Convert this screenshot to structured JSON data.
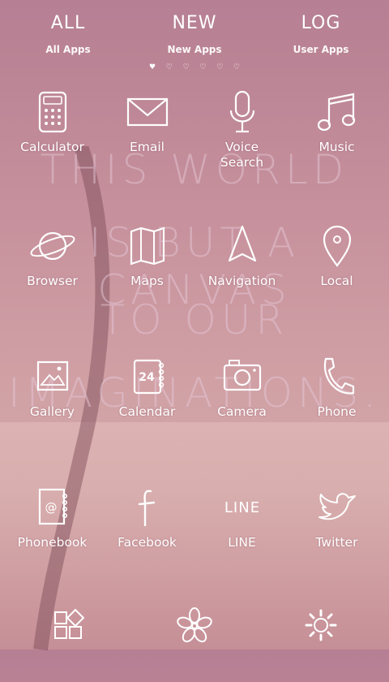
{
  "wallpaper": {
    "lines": [
      "THIS WORLD",
      "IS BUT A CANVAS",
      "TO OUR",
      "IMAGINATIONS."
    ]
  },
  "tabs": [
    {
      "symbol": "ALL",
      "label": "All Apps",
      "icon": "all-apps-icon"
    },
    {
      "symbol": "NEW",
      "label": "New Apps",
      "icon": "new-apps-icon"
    },
    {
      "symbol": "LOG",
      "label": "User Apps",
      "icon": "user-apps-icon"
    }
  ],
  "apps": [
    {
      "label": "Calculator",
      "icon": "calculator-icon"
    },
    {
      "label": "Email",
      "icon": "email-icon"
    },
    {
      "label": "Voice\nSearch",
      "icon": "microphone-icon"
    },
    {
      "label": "Music",
      "icon": "music-note-icon"
    },
    {
      "label": "Browser",
      "icon": "planet-icon"
    },
    {
      "label": "Maps",
      "icon": "map-icon"
    },
    {
      "label": "Navigation",
      "icon": "navigation-arrow-icon"
    },
    {
      "label": "Local",
      "icon": "location-pin-icon"
    },
    {
      "label": "Gallery",
      "icon": "picture-icon"
    },
    {
      "label": "Calendar",
      "icon": "calendar-icon"
    },
    {
      "label": "Camera",
      "icon": "camera-icon"
    },
    {
      "label": "Phone",
      "icon": "phone-handset-icon"
    },
    {
      "label": "Phonebook",
      "icon": "phonebook-icon"
    },
    {
      "label": "Facebook",
      "icon": "facebook-icon"
    },
    {
      "label": "LINE",
      "icon": "line-icon"
    },
    {
      "label": "Twitter",
      "icon": "twitter-bird-icon"
    }
  ],
  "calendar_day": "24",
  "line_icon_text": "LINE",
  "dock": [
    {
      "icon": "widgets-icon"
    },
    {
      "icon": "flower-icon"
    },
    {
      "icon": "settings-gear-icon"
    }
  ],
  "colors": {
    "icon_stroke": "#ffffff",
    "background_top": "#b67f93",
    "background_bottom": "#c8939a"
  }
}
